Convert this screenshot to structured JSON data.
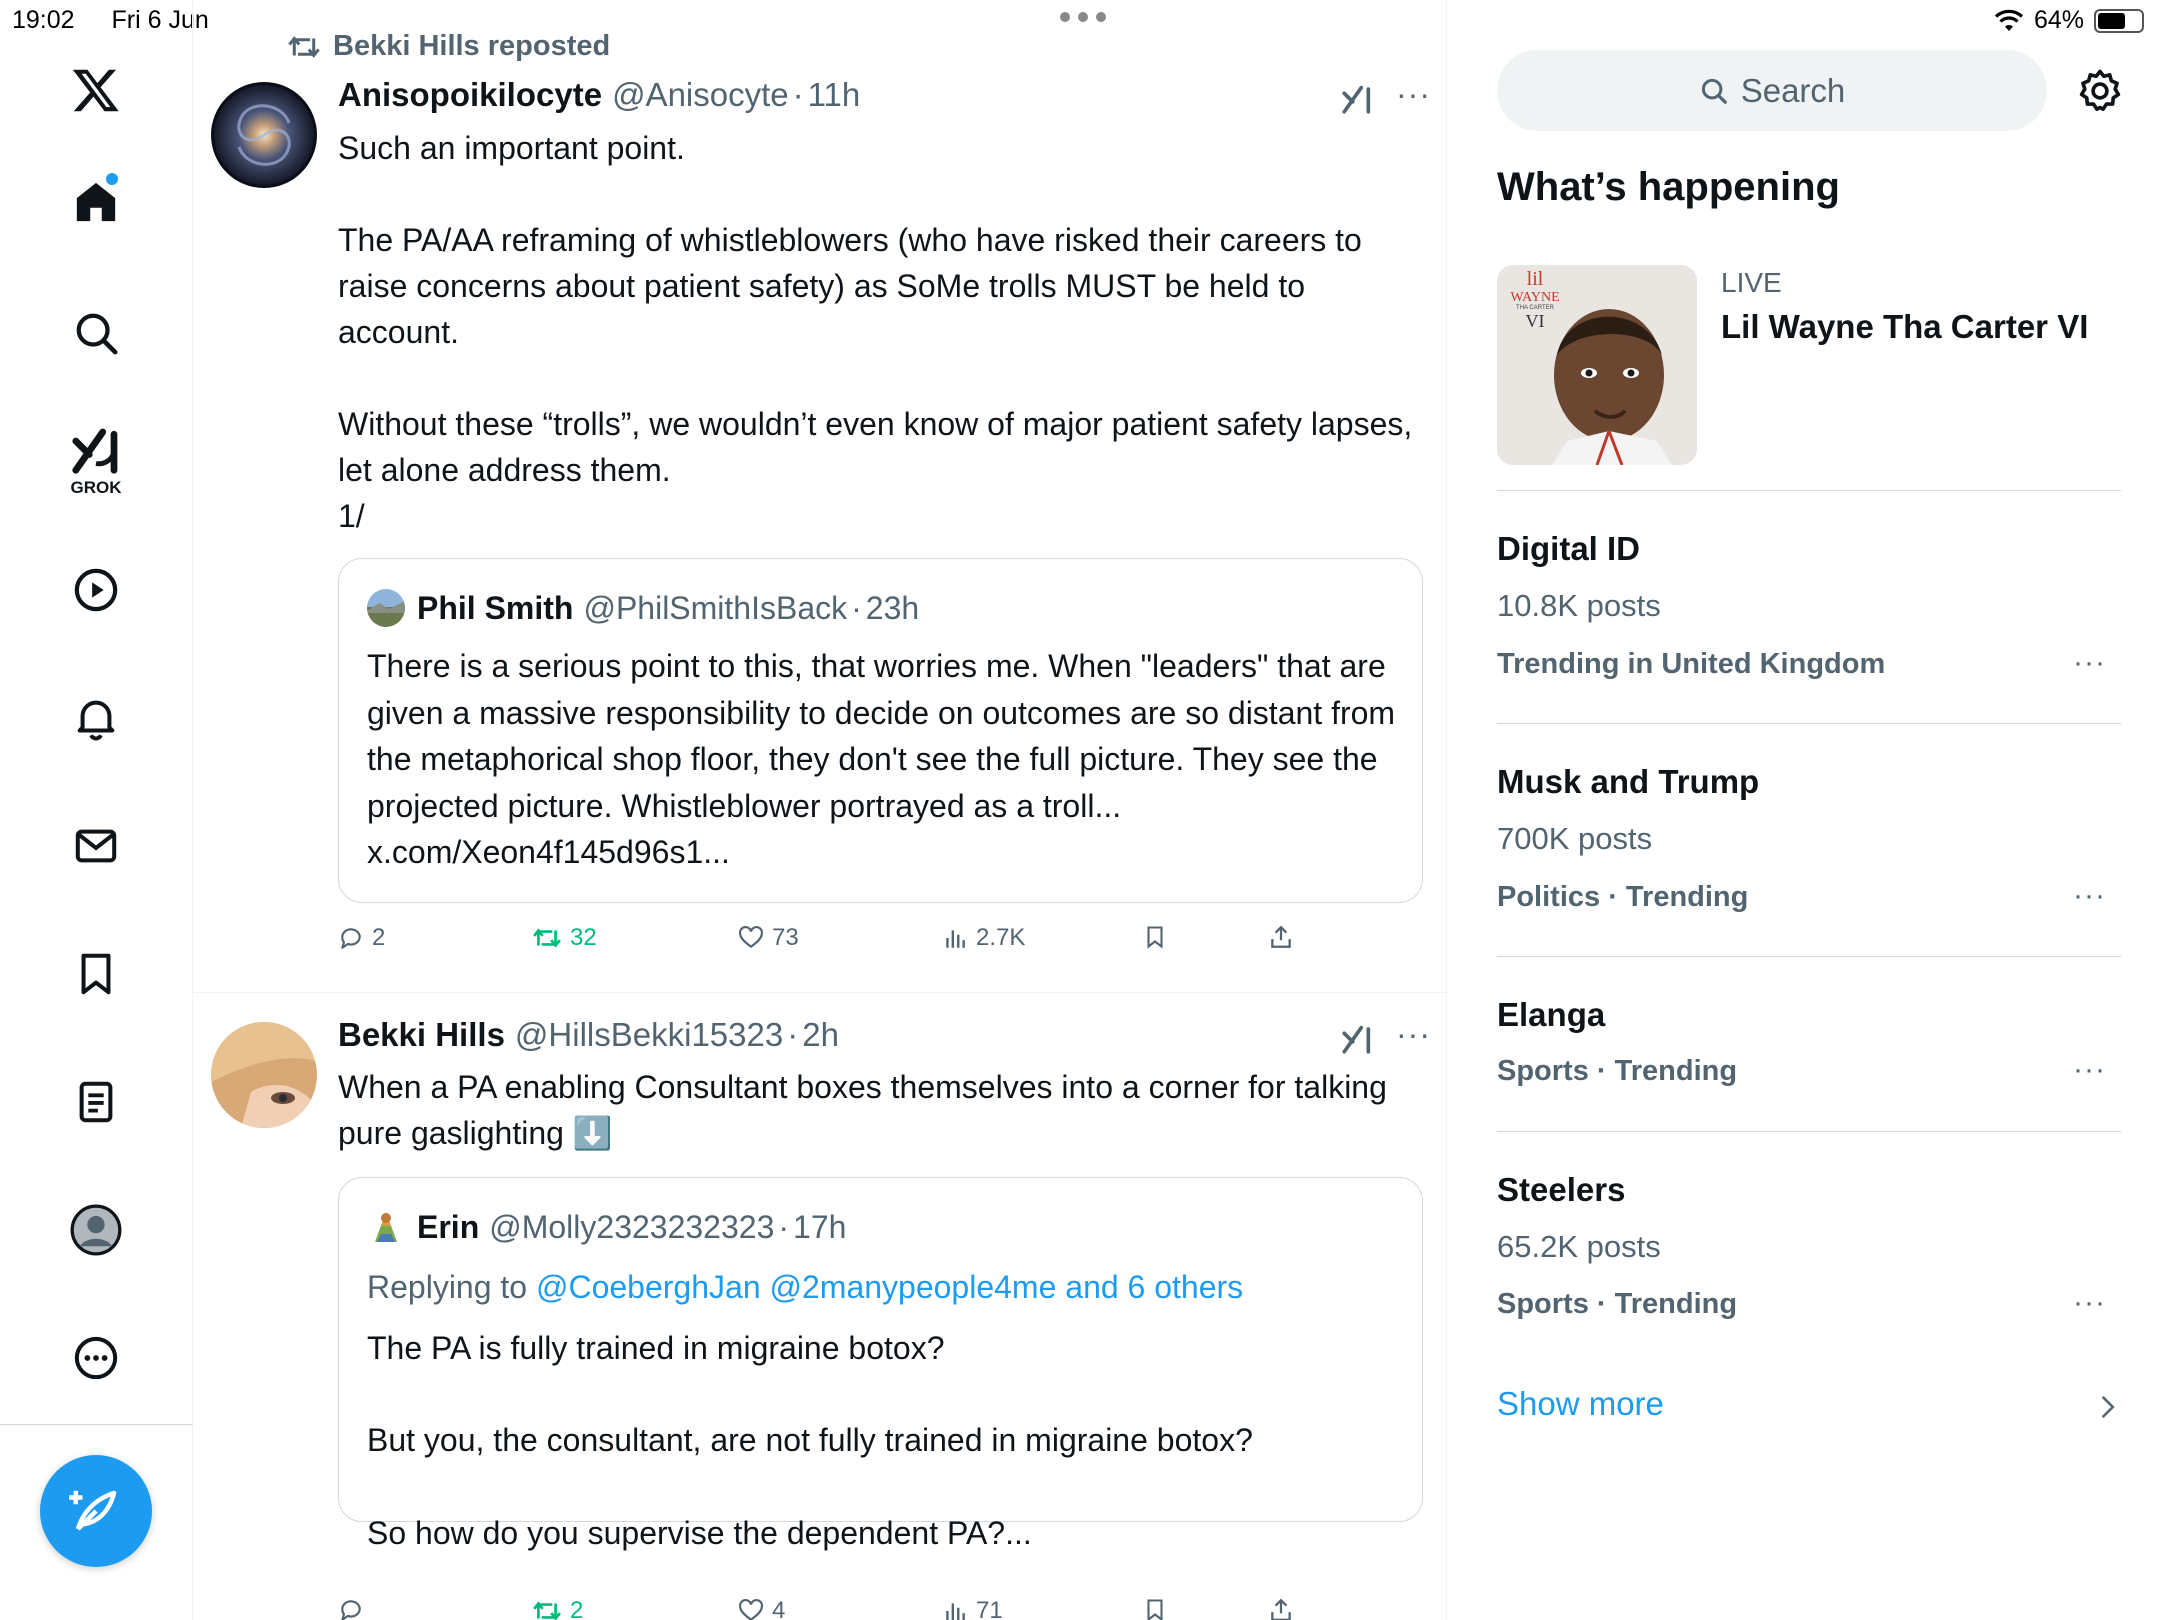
{
  "status_bar": {
    "time": "19:02",
    "date": "Fri 6 Jun",
    "battery": "64%",
    "battery_level": 0.64
  },
  "nav": {
    "items": [
      "logo-x",
      "home",
      "explore",
      "grok",
      "videos",
      "notifications",
      "messages",
      "bookmarks",
      "lists",
      "profile",
      "more"
    ],
    "grok_label": "GROK",
    "accent": "#1d9bf0"
  },
  "feed": {
    "posts": [
      {
        "repost_label": "Bekki Hills reposted",
        "author": "Anisopoikilocyte",
        "handle": "@Anisocyte",
        "time": "11h",
        "paragraphs": [
          "Such an important point.",
          "The PA/AA reframing of whistleblowers (who have risked their careers to raise concerns about patient safety) as SoMe trolls MUST be held to account.",
          "Without these “trolls”, we wouldn’t even know of major patient safety lapses, let alone address them.",
          "1/"
        ],
        "quote": {
          "author": "Phil Smith",
          "handle": "@PhilSmithIsBack",
          "time": "23h",
          "text": "There is a serious point to this, that worries me. When \"leaders\" that are given a massive responsibility to decide on outcomes are so distant from the metaphorical shop floor, they don't see the full picture. They see the projected picture. Whistleblower portrayed as a troll... x.com/Xeon4f145d96s1..."
        },
        "stats": {
          "replies": "2",
          "reposts": "32",
          "likes": "73",
          "views": "2.7K"
        }
      },
      {
        "author": "Bekki Hills",
        "handle": "@HillsBekki15323",
        "time": "2h",
        "text": "When a PA enabling Consultant boxes themselves into a corner for talking pure gaslighting ⬇️",
        "quote": {
          "author": "Erin",
          "handle": "@Molly2323232323",
          "time": "17h",
          "replying_prefix": "Replying to",
          "replying_to": "@CoeberghJan @2manypeople4me and 6 others",
          "paragraphs": [
            "The PA is fully trained in migraine botox?",
            "But you, the consultant, are not fully trained in migraine botox?",
            "So how do you supervise the dependent PA?..."
          ]
        },
        "stats": {
          "replies": "",
          "reposts": "2",
          "likes": "4",
          "views": "71"
        }
      }
    ]
  },
  "sidebar": {
    "search_placeholder": "Search",
    "section_title": "What’s happening",
    "live": {
      "label": "LIVE",
      "title": "Lil Wayne Tha Carter VI",
      "cover_text": [
        "lil",
        "WAYNE",
        "THA CARTER",
        "VI"
      ]
    },
    "trends": [
      {
        "title": "Digital ID",
        "posts": "10.8K posts",
        "meta": "Trending in United Kingdom"
      },
      {
        "title": "Musk and Trump",
        "posts": "700K posts",
        "meta": "Politics · Trending"
      },
      {
        "title": "Elanga",
        "posts": "",
        "meta": "Sports · Trending"
      },
      {
        "title": "Steelers",
        "posts": "65.2K posts",
        "meta": "Sports · Trending"
      }
    ],
    "show_more": "Show more"
  }
}
